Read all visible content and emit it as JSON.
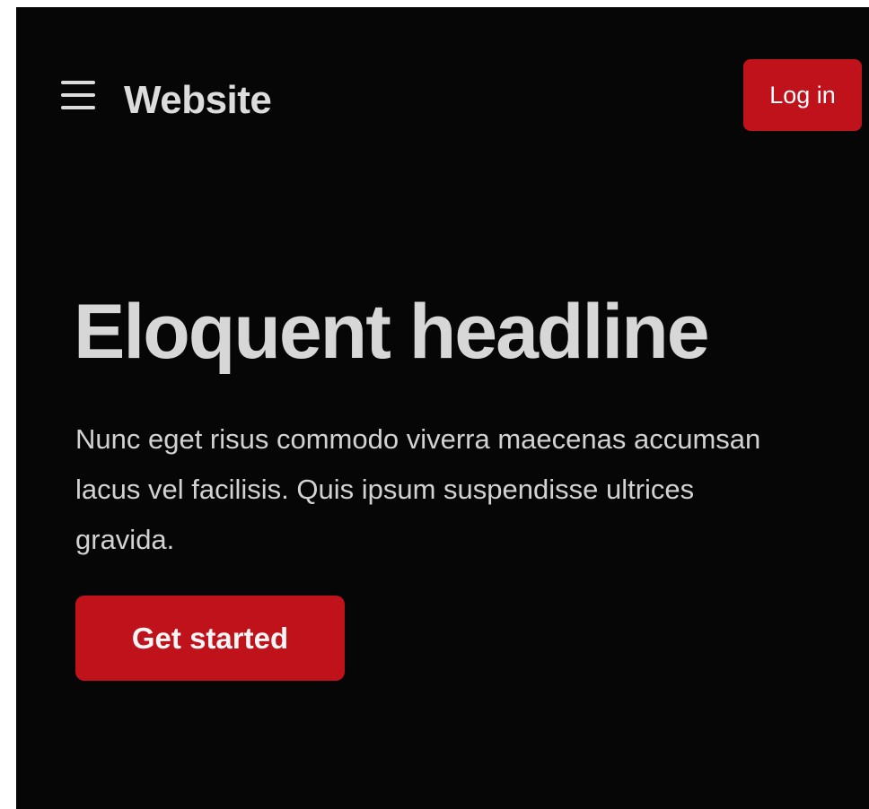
{
  "header": {
    "menu_icon": "hamburger-menu-icon",
    "site_title": "Website",
    "login_label": "Log in"
  },
  "hero": {
    "headline": "Eloquent headline",
    "body": "Nunc eget risus commodo viverra maecenas accumsan lacus vel facilisis. Quis ipsum suspendisse ultrices gravida.",
    "cta_label": "Get started"
  },
  "colors": {
    "background": "#060606",
    "accent": "#c0121b",
    "text": "#d7d7d7"
  }
}
